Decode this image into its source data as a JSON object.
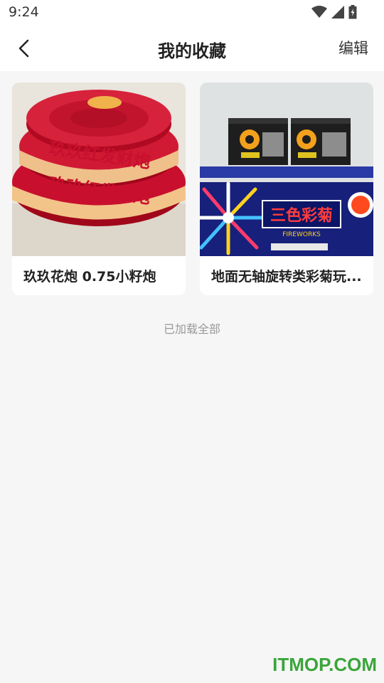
{
  "status_bar": {
    "time": "9:24"
  },
  "nav": {
    "title": "我的收藏",
    "edit_label": "编辑"
  },
  "products": [
    {
      "title": "玖玖花炮 0.75小籽炮",
      "image_text": "玖玖红发财炮"
    },
    {
      "title": "地面无轴旋转类彩菊玩...",
      "image_text": "三色彩菊",
      "image_subtext": "FIREWORKS"
    }
  ],
  "footer": {
    "text": "已加载全部"
  },
  "watermark": {
    "text": "ITMOP.COM"
  },
  "colors": {
    "accent_red": "#c8102e",
    "watermark_green": "#3aa53a",
    "page_bg": "#f6f6f6"
  }
}
